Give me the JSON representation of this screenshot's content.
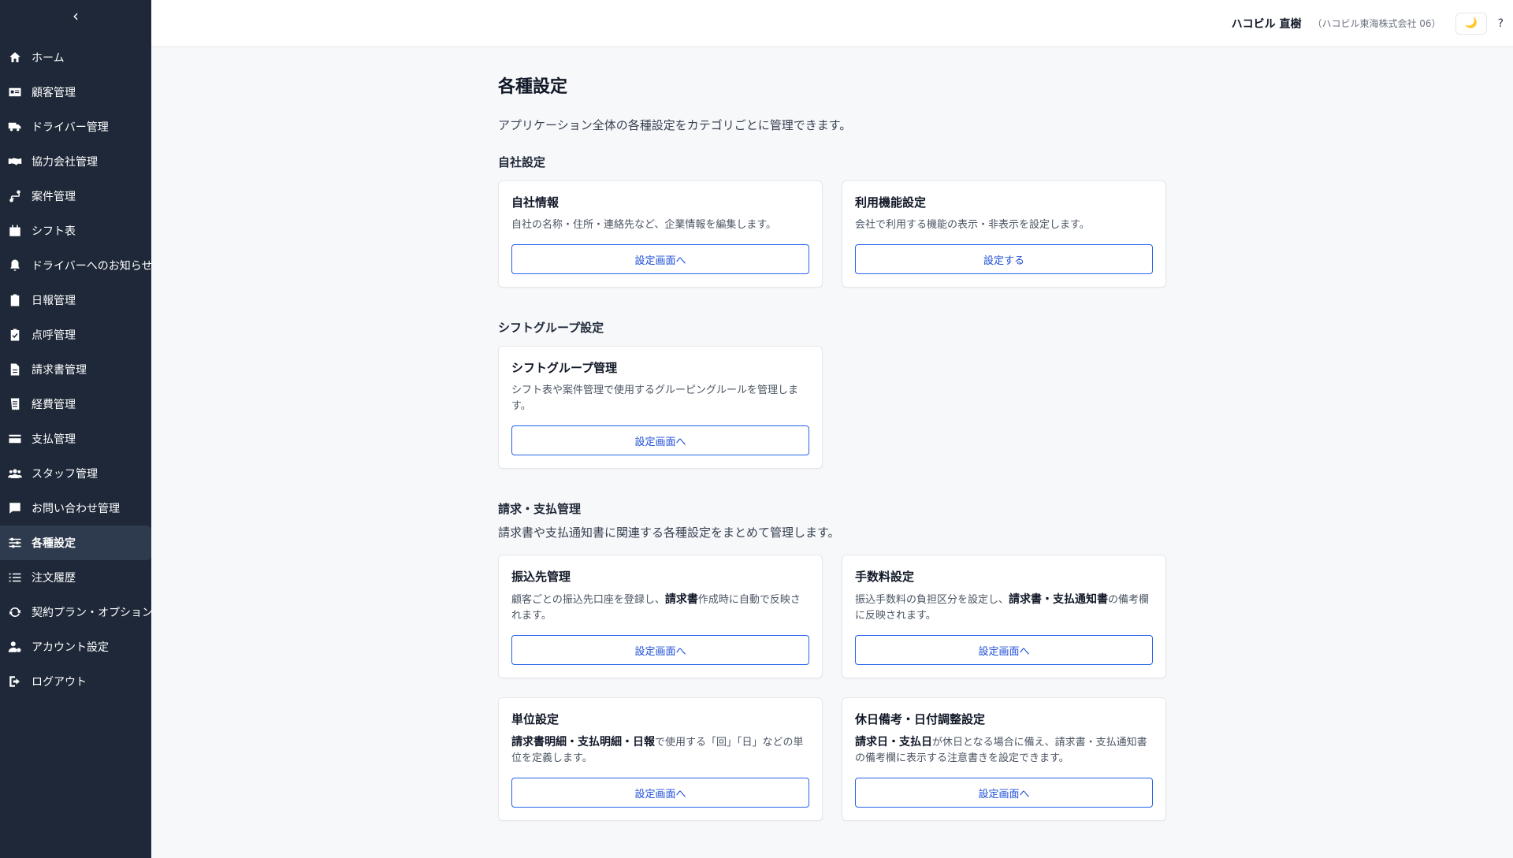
{
  "sidebar": {
    "collapse_glyph": "‹",
    "items": [
      {
        "label": "ホーム",
        "icon": "home-icon"
      },
      {
        "label": "顧客管理",
        "icon": "id-card-icon"
      },
      {
        "label": "ドライバー管理",
        "icon": "truck-icon"
      },
      {
        "label": "協力会社管理",
        "icon": "handshake-icon"
      },
      {
        "label": "案件管理",
        "icon": "route-icon"
      },
      {
        "label": "シフト表",
        "icon": "calendar-icon"
      },
      {
        "label": "ドライバーへのお知らせ",
        "icon": "bell-icon"
      },
      {
        "label": "日報管理",
        "icon": "clipboard-icon"
      },
      {
        "label": "点呼管理",
        "icon": "clipboard-check-icon"
      },
      {
        "label": "請求書管理",
        "icon": "file-icon"
      },
      {
        "label": "経費管理",
        "icon": "receipt-icon"
      },
      {
        "label": "支払管理",
        "icon": "credit-card-icon"
      },
      {
        "label": "スタッフ管理",
        "icon": "users-icon"
      },
      {
        "label": "お問い合わせ管理",
        "icon": "chat-icon"
      },
      {
        "label": "各種設定",
        "icon": "sliders-icon",
        "active": true
      },
      {
        "label": "注文履歴",
        "icon": "list-icon"
      },
      {
        "label": "契約プラン・オプション",
        "icon": "refresh-icon"
      },
      {
        "label": "アカウント設定",
        "icon": "user-gear-icon"
      },
      {
        "label": "ログアウト",
        "icon": "logout-icon"
      }
    ]
  },
  "header": {
    "user_name": "ハコビル 直樹",
    "company": "（ハコビル東海株式会社 06）",
    "theme_glyph": "🌙",
    "help_glyph": "?"
  },
  "main": {
    "title": "各種設定",
    "description": "アプリケーション全体の各種設定をカテゴリごとに管理できます。",
    "sections": [
      {
        "title": "自社設定",
        "cards": [
          {
            "title": "自社情報",
            "description": "自社の名称・住所・連絡先など、企業情報を編集します。",
            "button": "設定画面へ"
          },
          {
            "title": "利用機能設定",
            "description": "会社で利用する機能の表示・非表示を設定します。",
            "button": "設定する"
          }
        ]
      },
      {
        "title": "シフトグループ設定",
        "cards": [
          {
            "title": "シフトグループ管理",
            "description": "シフト表や案件管理で使用するグルーピングルールを管理します。",
            "button": "設定画面へ"
          }
        ]
      },
      {
        "title": "請求・支払管理",
        "description": "請求書や支払通知書に関連する各種設定をまとめて管理します。",
        "cards": [
          {
            "title": "振込先管理",
            "desc_pre": "顧客ごとの振込先口座を登録し、",
            "desc_bold": "請求書",
            "desc_post": "作成時に自動で反映されます。",
            "button": "設定画面へ"
          },
          {
            "title": "手数料設定",
            "desc_pre": "振込手数料の負担区分を設定し、",
            "desc_bold": "請求書・支払通知書",
            "desc_post": "の備考欄に反映されます。",
            "button": "設定画面へ"
          },
          {
            "title": "単位設定",
            "desc_pre": "",
            "desc_bold": "請求書明細・支払明細・日報",
            "desc_post": "で使用する「回」「日」などの単位を定義します。",
            "button": "設定画面へ"
          },
          {
            "title": "休日備考・日付調整設定",
            "desc_pre": "",
            "desc_bold": "請求日・支払日",
            "desc_post": "が休日となる場合に備え、請求書・支払通知書の備考欄に表示する注意書きを設定できます。",
            "button": "設定画面へ"
          }
        ]
      }
    ]
  }
}
